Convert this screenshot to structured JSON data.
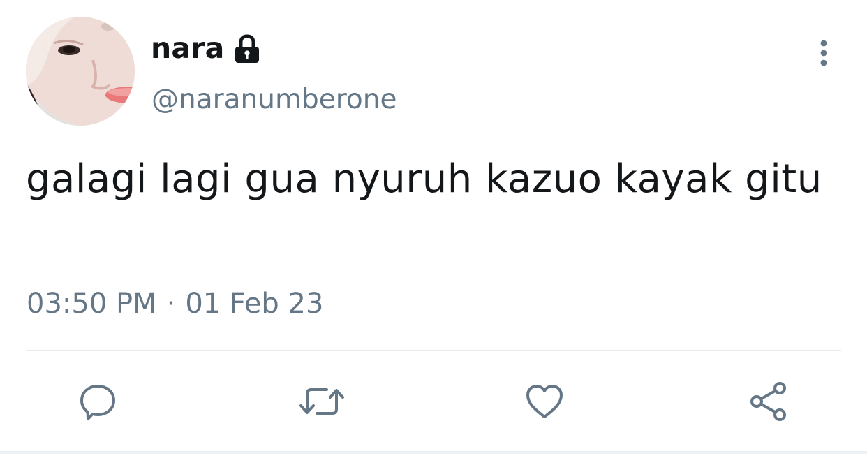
{
  "tweet": {
    "display_name": "nara",
    "handle": "@naranumberone",
    "text": "galagi lagi gua nyuruh kazuo kayak gitu",
    "time": "03:50 PM",
    "separator": "·",
    "date": "01 Feb 23",
    "protected_icon": "lock-icon"
  },
  "actions": {
    "reply_icon": "reply-icon",
    "retweet_icon": "retweet-icon",
    "like_icon": "heart-icon",
    "share_icon": "share-icon",
    "more_icon": "more-vertical-icon"
  },
  "colors": {
    "text_primary": "#14171a",
    "text_secondary": "#657786",
    "divider": "#e6ecf0"
  }
}
